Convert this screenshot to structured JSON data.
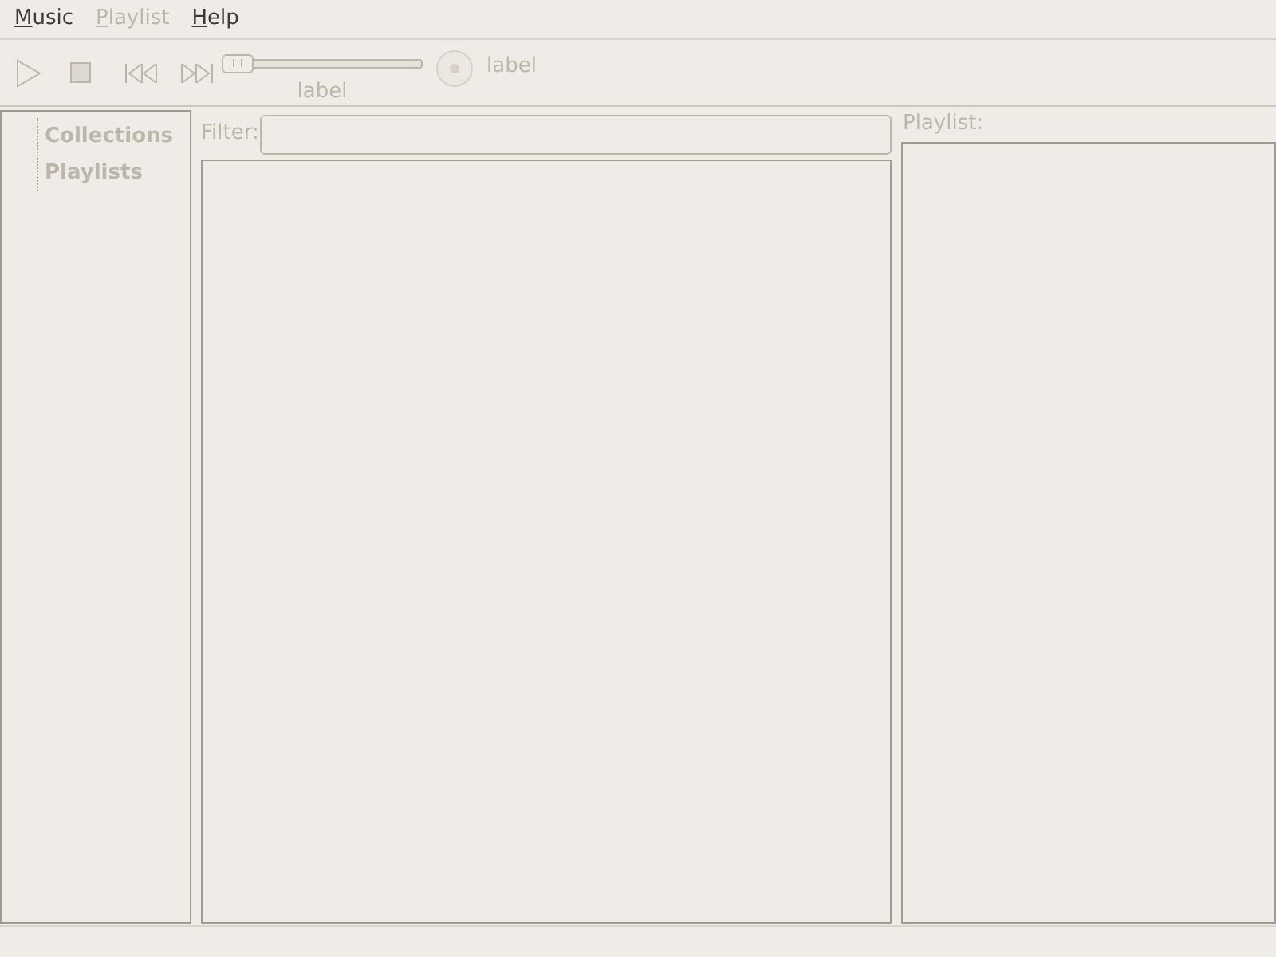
{
  "menu_bar": [
    {
      "label": "Music",
      "disabled": false
    },
    {
      "label": "Playlist",
      "disabled": true
    },
    {
      "label": "Help",
      "disabled": false
    }
  ],
  "toolbar": {
    "buttons": [
      {
        "kind": "play",
        "disabled": true
      },
      {
        "kind": "stop",
        "disabled": true
      },
      {
        "kind": "previous",
        "disabled": true
      },
      {
        "kind": "next",
        "disabled": true
      }
    ],
    "seek_slider": {
      "level": 0.0,
      "disabled": true
    },
    "seek_label": "label",
    "status_label": "label"
  },
  "sidebar": {
    "items": [
      {
        "label": "Collections",
        "disabled": true
      },
      {
        "label": "Playlists",
        "disabled": true
      }
    ]
  },
  "library": {
    "filter_label": "Filter:"
  },
  "playlist": {
    "label": "Playlist:"
  }
}
